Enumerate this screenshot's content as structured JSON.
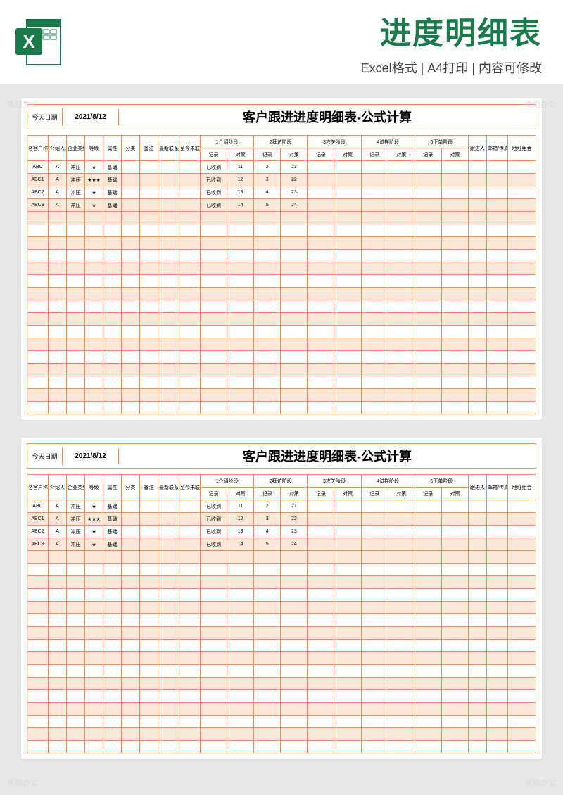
{
  "header": {
    "title": "进度明细表",
    "subtitle": "Excel格式 | A4打印 | 内容可修改"
  },
  "watermark": "熊猫办公",
  "sheet": {
    "dateLabel": "今天日期",
    "dateValue": "2021/8/12",
    "title": "客户跟进进度明细表-公式计算",
    "columns": {
      "clientName": "名客户称",
      "introducer": "介绍人",
      "companyType": "企业类型",
      "level": "等级",
      "attribute": "属性",
      "category": "分类",
      "remark": "备注",
      "lastContact": "最新联系日期",
      "daysNoContact": "至今未联系天数",
      "stage1": "1介绍阶段",
      "stage2": "2拜访阶段",
      "stage3": "3攻关阶段",
      "stage4": "4试样阶段",
      "stage5": "5下单阶段",
      "record": "记录",
      "measure": "对策",
      "follower": "跟进人",
      "contact": "邮箱/传真/QQ",
      "address": "地址组合"
    },
    "rows": [
      {
        "name": "ABC",
        "intro": "A",
        "type": "冲压",
        "level": "★",
        "attr": "基础",
        "s1r": "已收到",
        "s1m": "11",
        "s2r": "2",
        "s2m": "21"
      },
      {
        "name": "ABC1",
        "intro": "A",
        "type": "冲压",
        "level": "★★★",
        "attr": "基础",
        "s1r": "已收到",
        "s1m": "12",
        "s2r": "3",
        "s2m": "22"
      },
      {
        "name": "ABC2",
        "intro": "A",
        "type": "冲压",
        "level": "★",
        "attr": "基础",
        "s1r": "已收到",
        "s1m": "13",
        "s2r": "4",
        "s2m": "23"
      },
      {
        "name": "ABC3",
        "intro": "A",
        "type": "冲压",
        "level": "★",
        "attr": "基础",
        "s1r": "已收到",
        "s1m": "14",
        "s2r": "5",
        "s2m": "24"
      }
    ],
    "emptyRows": 16
  }
}
